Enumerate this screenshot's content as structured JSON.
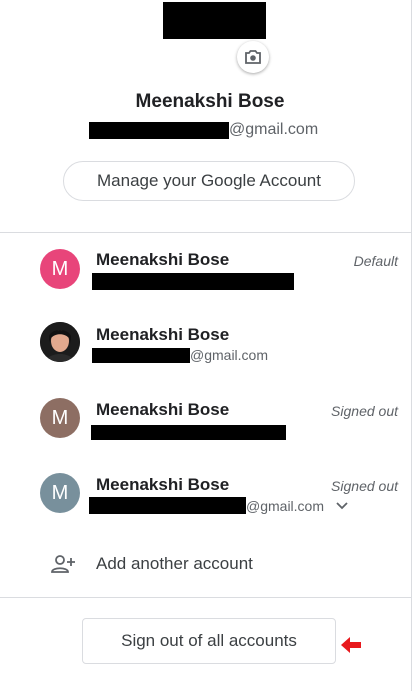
{
  "header": {
    "name": "Meenakshi Bose",
    "email_suffix": "@gmail.com",
    "manage_button_label": "Manage your Google Account"
  },
  "accounts": [
    {
      "initial": "M",
      "avatar_color": "#e8457a",
      "name": "Meenakshi Bose",
      "email_suffix": "",
      "status": "Default"
    },
    {
      "initial": "",
      "avatar_color": "#1f1f1f",
      "name": "Meenakshi Bose",
      "email_suffix": "@gmail.com",
      "status": ""
    },
    {
      "initial": "M",
      "avatar_color": "#8d6e63",
      "name": "Meenakshi Bose",
      "email_suffix": "",
      "status": "Signed out"
    },
    {
      "initial": "M",
      "avatar_color": "#78909c",
      "name": "Meenakshi Bose",
      "email_suffix": "@gmail.com",
      "status": "Signed out"
    }
  ],
  "add_account_label": "Add another account",
  "sign_out_label": "Sign out of all accounts",
  "colors": {
    "arrow": "#e8191d",
    "divider": "#dadce0"
  }
}
